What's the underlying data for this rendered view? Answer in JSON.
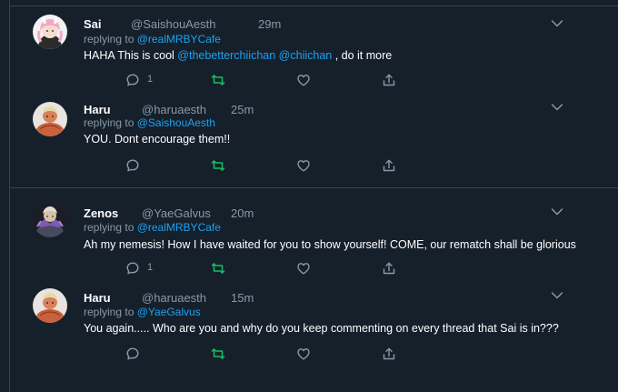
{
  "tweets": [
    {
      "name": "Sai",
      "handle": "@SaishouAesth",
      "time": "29m",
      "reply_prefix": "replying to ",
      "reply_to": "@realMRBYCafe",
      "text_a": "HAHA This is cool ",
      "mention_1": "@thebetterchiichan",
      "mention_2": "@chiichan",
      "text_b": " , do it more",
      "reply_count": "1",
      "avatar": "pink-haired-avatar"
    },
    {
      "name": "Haru",
      "handle": "@haruaesth",
      "time": "25m",
      "reply_prefix": "replying to ",
      "reply_to": "@SaishouAesth",
      "text": "YOU. Dont encourage them!!",
      "reply_count": "",
      "avatar": "muscular-avatar"
    },
    {
      "name": "Zenos",
      "handle": "@YaeGalvus",
      "time": "20m",
      "reply_prefix": "replying to ",
      "reply_to": "@realMRBYCafe",
      "text": "Ah my nemesis! How I have waited for you to show yourself! COME, our rematch shall be glorious",
      "reply_count": "1",
      "avatar": "armored-avatar"
    },
    {
      "name": "Haru",
      "handle": "@haruaesth",
      "time": "15m",
      "reply_prefix": "replying to ",
      "reply_to": "@YaeGalvus",
      "text": "You again..... Who are you and why do you keep commenting on every thread that Sai is in???",
      "reply_count": "",
      "avatar": "muscular-avatar"
    }
  ],
  "icons": {
    "reply": "reply-icon",
    "retweet": "retweet-icon",
    "like": "heart-icon",
    "share": "share-icon",
    "menu": "chevron-down-icon"
  },
  "colors": {
    "background": "#15202b",
    "divider": "#38444d",
    "link": "#1da1f2",
    "muted": "#8899a6",
    "retweet": "#17bf63"
  }
}
